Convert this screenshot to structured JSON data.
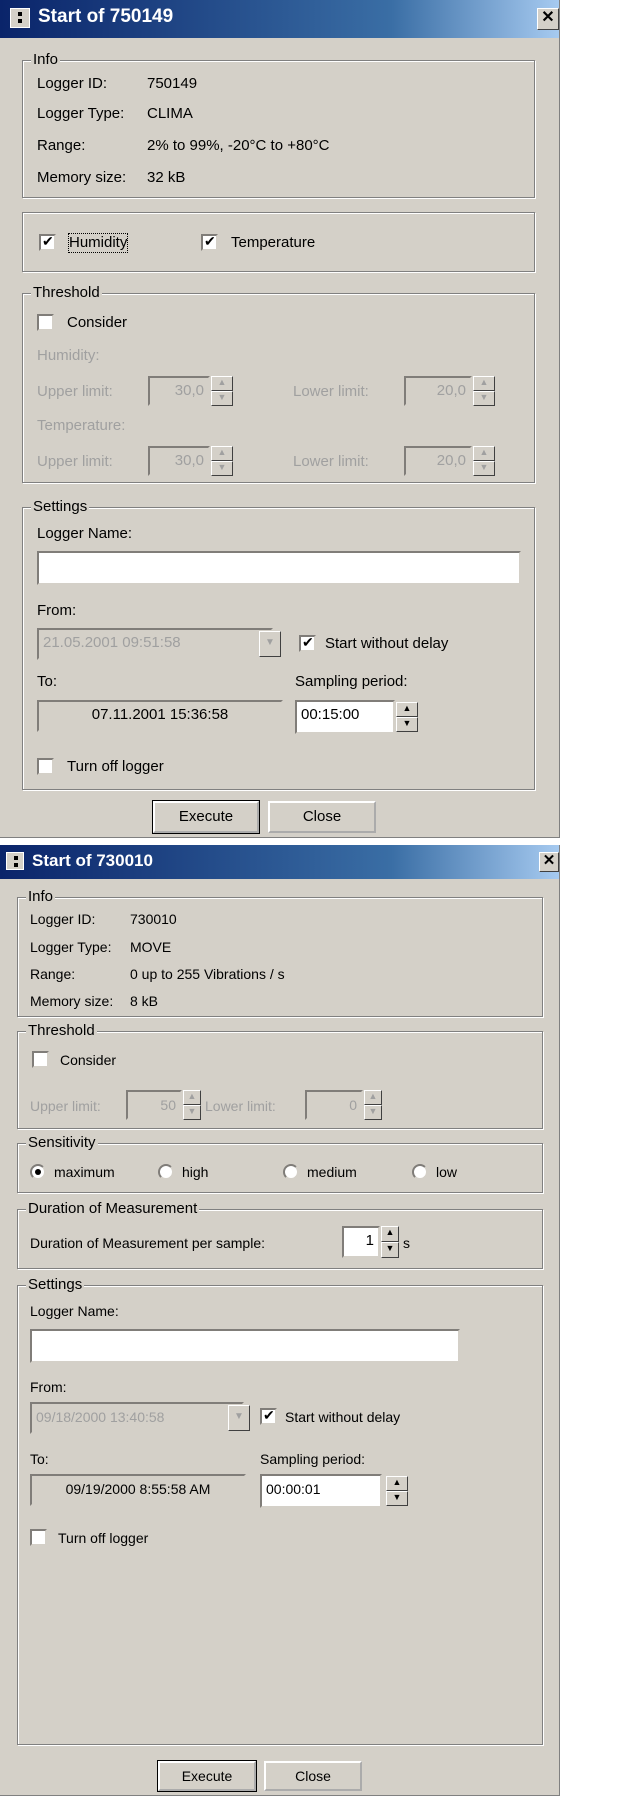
{
  "dialog1": {
    "title": "Start of 750149",
    "info": {
      "legend": "Info",
      "logger_id_label": "Logger ID:",
      "logger_id": "750149",
      "logger_type_label": "Logger Type:",
      "logger_type": "CLIMA",
      "range_label": "Range:",
      "range": "2% to 99%, -20°C to +80°C",
      "memory_label": "Memory size:",
      "memory": "32 kB"
    },
    "channels": {
      "humidity": "Humidity",
      "temperature": "Temperature"
    },
    "threshold": {
      "legend": "Threshold",
      "consider": "Consider",
      "humidity_label": "Humidity:",
      "temperature_label": "Temperature:",
      "upper_label": "Upper limit:",
      "lower_label": "Lower limit:",
      "hum_upper": "30,0",
      "hum_lower": "20,0",
      "temp_upper": "30,0",
      "temp_lower": "20,0"
    },
    "settings": {
      "legend": "Settings",
      "logger_name_label": "Logger Name:",
      "logger_name": "",
      "from_label": "From:",
      "from_value": "21.05.2001 09:51:58",
      "start_without_delay": "Start without delay",
      "to_label": "To:",
      "to_value": "07.11.2001 15:36:58",
      "sampling_label": "Sampling period:",
      "sampling_value": "00:15:00",
      "turn_off": "Turn off logger"
    },
    "buttons": {
      "execute": "Execute",
      "close": "Close"
    }
  },
  "dialog2": {
    "title": "Start of 730010",
    "info": {
      "legend": "Info",
      "logger_id_label": "Logger ID:",
      "logger_id": "730010",
      "logger_type_label": "Logger Type:",
      "logger_type": "MOVE",
      "range_label": "Range:",
      "range": "0 up to 255 Vibrations / s",
      "memory_label": "Memory size:",
      "memory": "8 kB"
    },
    "threshold": {
      "legend": "Threshold",
      "consider": "Consider",
      "upper_label": "Upper limit:",
      "upper": "50",
      "lower_label": "Lower limit:",
      "lower": "0"
    },
    "sensitivity": {
      "legend": "Sensitivity",
      "maximum": "maximum",
      "high": "high",
      "medium": "medium",
      "low": "low"
    },
    "duration": {
      "legend": "Duration of Measurement",
      "label": "Duration of Measurement per sample:",
      "value": "1",
      "unit": "s"
    },
    "settings": {
      "legend": "Settings",
      "logger_name_label": "Logger Name:",
      "logger_name": "",
      "from_label": "From:",
      "from_value": "09/18/2000 13:40:58",
      "start_without_delay": "Start without delay",
      "to_label": "To:",
      "to_value": "09/19/2000 8:55:58 AM",
      "sampling_label": "Sampling period:",
      "sampling_value": "00:00:01",
      "turn_off": "Turn off logger"
    },
    "buttons": {
      "execute": "Execute",
      "close": "Close"
    }
  }
}
